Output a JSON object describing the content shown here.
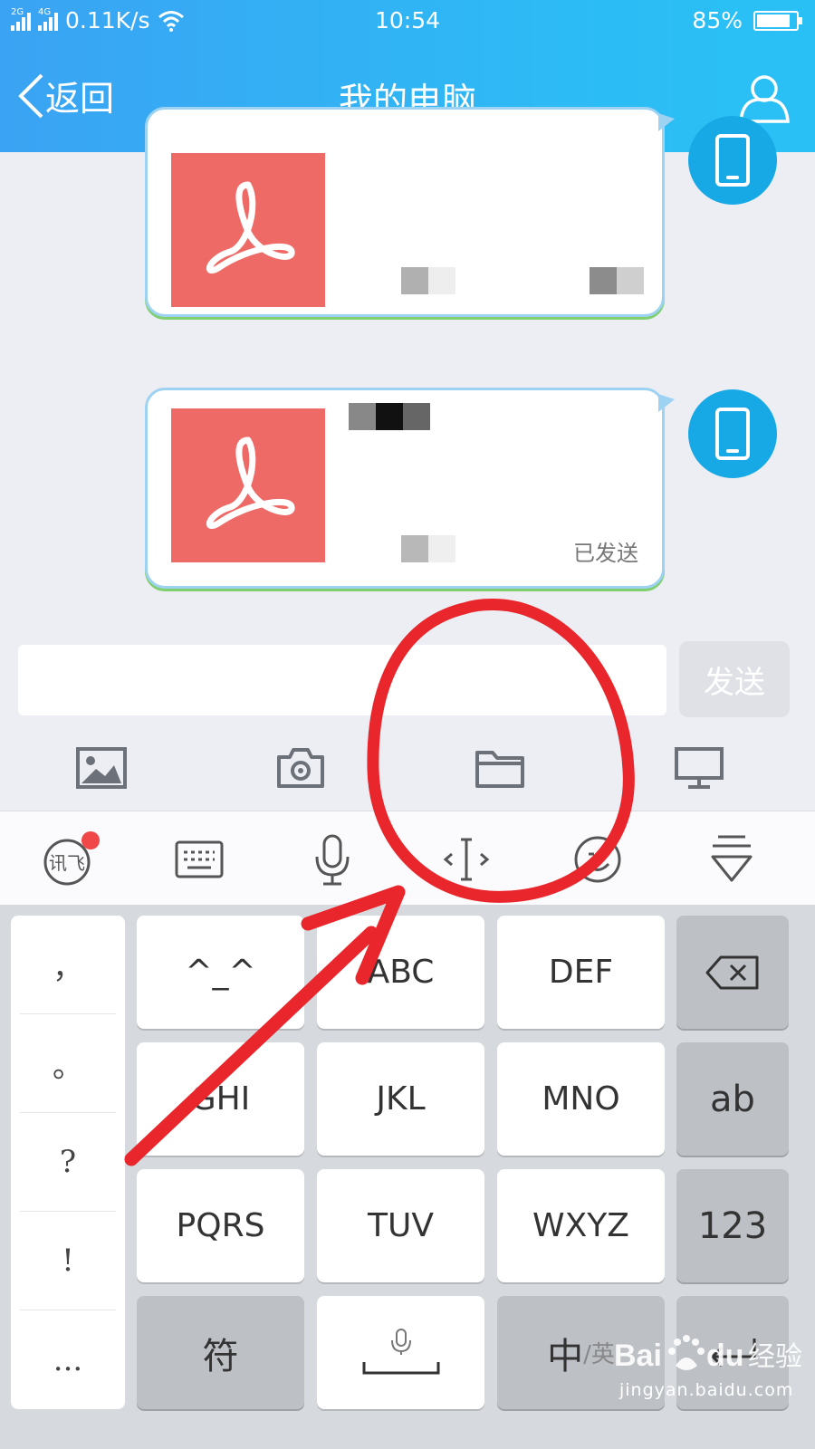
{
  "status_bar": {
    "signal_1": "2G",
    "signal_2": "4G",
    "net_speed": "0.11K/s",
    "time": "10:54",
    "battery": "85%",
    "battery_level": 85
  },
  "header": {
    "back_label": "返回",
    "title": "我的电脑",
    "icons": [
      "chevron-left-icon",
      "user-icon"
    ]
  },
  "messages": [
    {
      "file_icon": "pdf-icon",
      "status": "",
      "sender_icon": "phone-icon"
    },
    {
      "file_icon": "pdf-icon",
      "status": "已发送",
      "sender_icon": "phone-icon"
    }
  ],
  "composer": {
    "input_value": "",
    "send_label": "发送"
  },
  "tools": [
    "image-icon",
    "camera-icon",
    "folder-icon",
    "computer-icon"
  ],
  "keyboard": {
    "toolbar": {
      "xunfei_label": "讯飞",
      "icons": [
        "xunfei-icon",
        "keyboard-icon",
        "microphone-icon",
        "cursor-icon",
        "emoji-icon",
        "hide-keyboard-icon"
      ]
    },
    "punctuation": [
      "，",
      "。",
      "?",
      "!",
      "..."
    ],
    "keys": {
      "emoticon": "^_^",
      "abc": "ABC",
      "def": "DEF",
      "ghi": "GHI",
      "jkl": "JKL",
      "mno": "MNO",
      "pqrs": "PQRS",
      "tuv": "TUV",
      "wxyz": "WXYZ",
      "ab": "ab",
      "num": "123",
      "symbols": "符",
      "zh": "中",
      "en": "/英"
    }
  },
  "watermark": {
    "text_1": "Bai",
    "text_2": "du",
    "text_3": "经验",
    "url": "jingyan.baidu.com"
  },
  "colors": {
    "header": "#2db6f4",
    "pdf": "#ee6a67",
    "avatar": "#17a9e6",
    "annotation": "#e8262b"
  }
}
